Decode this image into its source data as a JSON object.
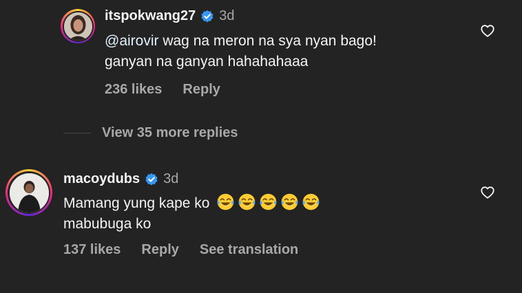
{
  "comments": [
    {
      "username": "itspokwang27",
      "time": "3d",
      "mention": "@airovir",
      "line1_rest": " wag na meron na sya nyan bago!",
      "line2": "ganyan na ganyan hahahahaaa",
      "likes": "236 likes",
      "reply": "Reply",
      "verified": true
    },
    {
      "username": "macoydubs",
      "time": "3d",
      "line1": "Mamang yung kape ko",
      "emojis": [
        "joy-emoji",
        "joy-emoji",
        "joy-emoji",
        "joy-emoji",
        "joy-emoji"
      ],
      "line2": "mabubuga ko",
      "likes": "137 likes",
      "reply": "Reply",
      "translate": "See translation",
      "verified": true
    }
  ],
  "view_replies": "View 35 more replies",
  "icons": {
    "heart": "heart-outline-icon",
    "verified": "verified-badge-icon"
  },
  "colors": {
    "background": "#232323",
    "verified": "#3797f0",
    "secondary_text": "#a8a8a8"
  }
}
